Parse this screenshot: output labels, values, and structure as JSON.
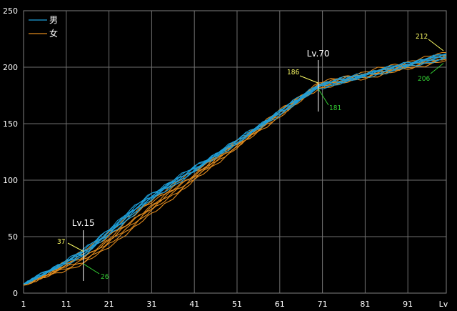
{
  "chart_data": {
    "type": "line",
    "title": "",
    "xlabel": "Lv",
    "ylabel": "",
    "xlim": [
      1,
      100
    ],
    "ylim": [
      0,
      250
    ],
    "x_ticks": [
      "1",
      "11",
      "21",
      "31",
      "41",
      "51",
      "61",
      "71",
      "81",
      "91",
      "Lv"
    ],
    "y_ticks": [
      "0",
      "50",
      "100",
      "150",
      "200",
      "250"
    ],
    "grid": true,
    "legend_position": "top-left",
    "colors": {
      "male": "#1e9ed8",
      "female": "#e08a1e",
      "background": "#000000",
      "grid": "#707070"
    },
    "legend": [
      {
        "label": "男",
        "color": "#1e9ed8"
      },
      {
        "label": "女",
        "color": "#e08a1e"
      }
    ],
    "annotations": {
      "lv15": {
        "label": "Lv.15",
        "x": 15,
        "max": "37",
        "min": "26"
      },
      "lv70": {
        "label": "Lv.70",
        "x": 70,
        "max": "186",
        "min": "181"
      },
      "lv100": {
        "max": "212",
        "min": "206"
      }
    },
    "x": [
      1,
      15,
      20,
      30,
      50,
      70,
      100
    ],
    "series": [
      {
        "name": "男",
        "values": [
          8,
          38,
          54,
          86,
          133,
          184,
          212
        ]
      },
      {
        "name": "",
        "values": [
          8,
          36,
          52,
          84,
          132,
          183,
          211
        ]
      },
      {
        "name": "",
        "values": [
          8,
          35,
          51,
          83,
          131,
          183,
          210
        ]
      },
      {
        "name": "",
        "values": [
          8,
          34,
          49,
          81,
          131,
          182,
          209
        ]
      },
      {
        "name": "",
        "values": [
          8,
          33,
          48,
          80,
          130,
          181,
          208
        ]
      },
      {
        "name": "",
        "values": [
          8,
          37,
          53,
          85,
          133,
          185,
          212
        ]
      },
      {
        "name": "",
        "values": [
          8,
          35,
          50,
          83,
          132,
          184,
          211
        ]
      },
      {
        "name": "女",
        "values": [
          7,
          37,
          51,
          80,
          132,
          186,
          213
        ]
      },
      {
        "name": "",
        "values": [
          7,
          32,
          45,
          75,
          130,
          184,
          211
        ]
      },
      {
        "name": "",
        "values": [
          7,
          30,
          42,
          72,
          128,
          183,
          209
        ]
      },
      {
        "name": "",
        "values": [
          7,
          28,
          40,
          70,
          127,
          182,
          208
        ]
      },
      {
        "name": "",
        "values": [
          7,
          26,
          38,
          67,
          126,
          181,
          206
        ]
      },
      {
        "name": "",
        "values": [
          7,
          34,
          48,
          78,
          131,
          185,
          210
        ]
      },
      {
        "name": "",
        "values": [
          7,
          31,
          44,
          74,
          129,
          183,
          207
        ]
      }
    ]
  }
}
